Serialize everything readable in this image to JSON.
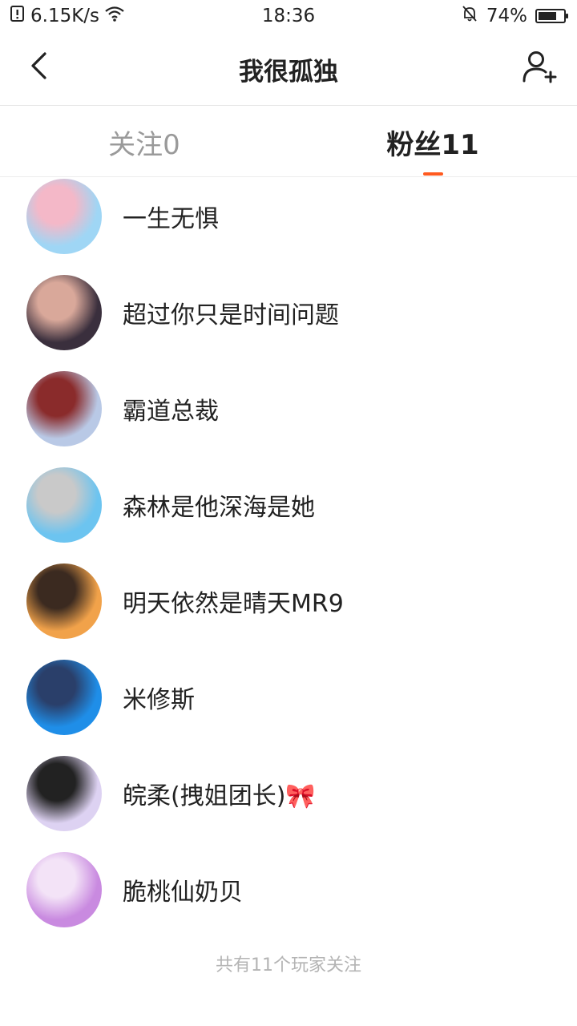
{
  "status_bar": {
    "speed": "6.15K/s",
    "time": "18:36",
    "battery_percent": "74%",
    "battery_level": 0.74,
    "icons": [
      "sim-alert-icon",
      "wifi-icon",
      "mute-bell-icon",
      "battery-icon"
    ]
  },
  "header": {
    "title": "我很孤独",
    "back_icon": "back-arrow-icon",
    "add_icon": "add-user-icon"
  },
  "tabs": {
    "follow_label": "关注0",
    "fans_label": "粉丝11",
    "active": "fans",
    "accent_color": "#ff5a1f"
  },
  "followers": [
    {
      "name": "一生无惧",
      "avatar_colors": [
        "#9fd6f5",
        "#f4b8c8"
      ]
    },
    {
      "name": "超过你只是时间问题",
      "avatar_colors": [
        "#3a2f3d",
        "#d9a89a"
      ]
    },
    {
      "name": "霸道总裁",
      "avatar_colors": [
        "#b9c9e6",
        "#8a2b2b"
      ]
    },
    {
      "name": "森林是他深海是她",
      "avatar_colors": [
        "#6cc4f0",
        "#c9c9c9"
      ]
    },
    {
      "name": "明天依然是晴天MR9",
      "avatar_colors": [
        "#f1a24a",
        "#3b2a20"
      ]
    },
    {
      "name": "米修斯",
      "avatar_colors": [
        "#1f8ee8",
        "#2a3f6a"
      ]
    },
    {
      "name": "皖柔(拽姐团长)🎀",
      "avatar_colors": [
        "#ddd2f2",
        "#222222"
      ]
    },
    {
      "name": "脆桃仙奶贝",
      "avatar_colors": [
        "#c98ae0",
        "#f3e3f7"
      ]
    }
  ],
  "footer_text": "共有11个玩家关注"
}
